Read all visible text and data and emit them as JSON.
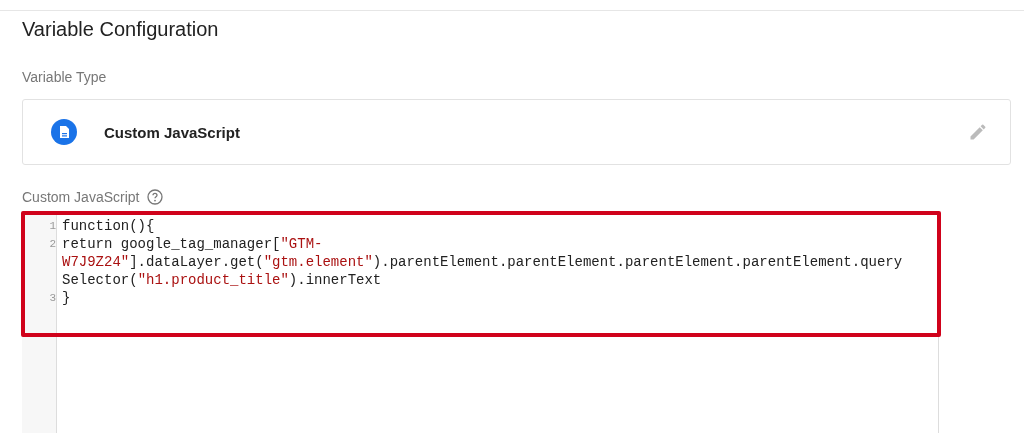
{
  "title": "Variable Configuration",
  "variable_type": {
    "label": "Variable Type",
    "name": "Custom JavaScript"
  },
  "editor": {
    "label": "Custom JavaScript",
    "lines": [
      {
        "number": "1",
        "rows": [
          [
            {
              "kind": "plain",
              "text": "function(){"
            }
          ]
        ]
      },
      {
        "number": "2",
        "rows": [
          [
            {
              "kind": "plain",
              "text": "return google_tag_manager["
            },
            {
              "kind": "string",
              "text": "\"GTM-"
            }
          ],
          [
            {
              "kind": "string",
              "text": "W7J9Z24\""
            },
            {
              "kind": "plain",
              "text": "].dataLayer.get("
            },
            {
              "kind": "string",
              "text": "\"gtm.element\""
            },
            {
              "kind": "plain",
              "text": ").parentElement.parentElement.parentElement.parentElement.query"
            }
          ],
          [
            {
              "kind": "plain",
              "text": "Selector("
            },
            {
              "kind": "string",
              "text": "\"h1.product_title\""
            },
            {
              "kind": "plain",
              "text": ").innerText"
            }
          ]
        ]
      },
      {
        "number": "3",
        "rows": [
          [
            {
              "kind": "plain",
              "text": "}"
            }
          ]
        ]
      }
    ]
  }
}
